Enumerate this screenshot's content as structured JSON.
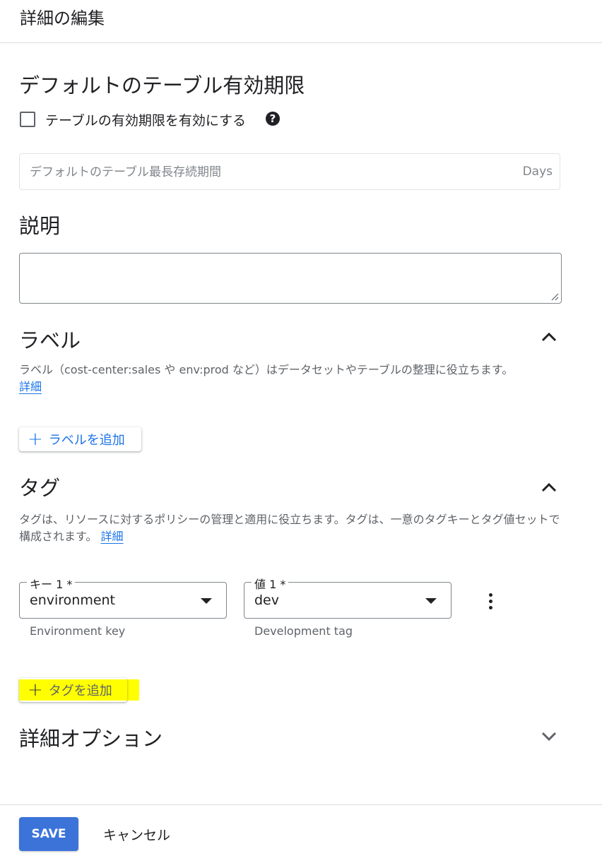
{
  "header": {
    "title": "詳細の編集"
  },
  "expiration": {
    "heading": "デフォルトのテーブル有効期限",
    "checkbox_label": "テーブルの有効期限を有効にする",
    "help_glyph": "?",
    "max_duration_placeholder": "デフォルトのテーブル最長存続期間",
    "max_duration_value": "",
    "suffix": "Days"
  },
  "description": {
    "heading": "説明",
    "value": ""
  },
  "labels": {
    "heading": "ラベル",
    "text": "ラベル（cost-center:sales や env:prod など）はデータセットやテーブルの整理に役立ちます。",
    "link": "詳細",
    "add_button": "ラベルを追加"
  },
  "tags": {
    "heading": "タグ",
    "text": "タグは、リソースに対するポリシーの管理と適用に役立ちます。タグは、一意のタグキーとタグ値セットで構成されます。",
    "link": "詳細",
    "rows": [
      {
        "key_label": "キー 1 *",
        "key_value": "environment",
        "key_hint": "Environment key",
        "value_label": "値 1 *",
        "value_value": "dev",
        "value_hint": "Development tag"
      }
    ],
    "add_button": "タグを追加",
    "highlight_color": "#ffff00"
  },
  "advanced": {
    "heading": "詳細オプション"
  },
  "footer": {
    "save": "SAVE",
    "cancel": "キャンセル"
  },
  "colors": {
    "accent": "#1a73e8",
    "save_bg": "#3b73d9"
  }
}
